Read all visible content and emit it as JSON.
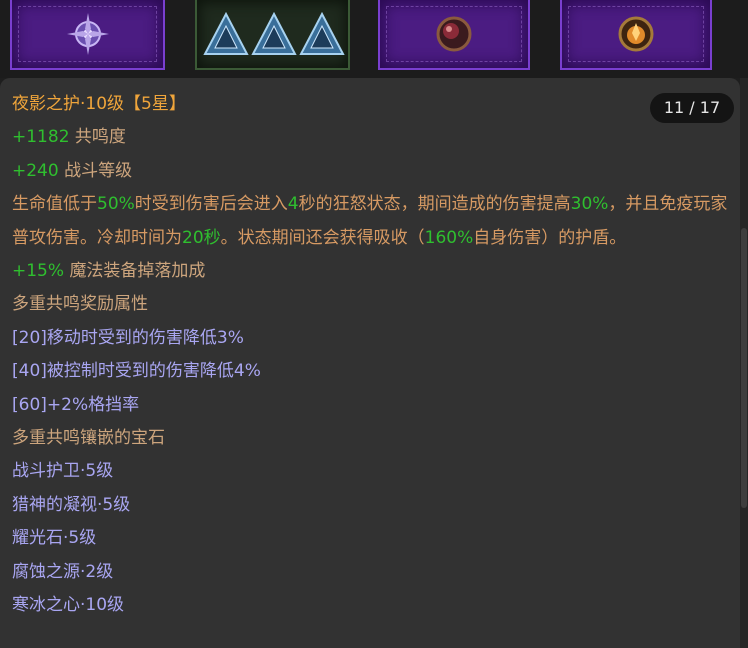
{
  "counter": "11 / 17",
  "item": {
    "name": "夜影之护·10级【5星】",
    "stats": [
      {
        "value": "+1182",
        "label": "共鸣度"
      },
      {
        "value": "+240",
        "label": "战斗等级"
      }
    ],
    "effect": {
      "p1": "生命值低于",
      "v1": "50%",
      "p2": "时受到伤害后会进入",
      "v2": "4",
      "p3": "秒的狂怒状态，期间造成的伤害提高",
      "v3": "30%",
      "p4": "，并且免疫玩家普攻伤害。冷却时间为",
      "v4": "20秒",
      "p5": "。状态期间还会获得吸收（",
      "v5": "160%",
      "p6": "自身伤害）的护盾。"
    },
    "magic_find": {
      "value": "+15%",
      "label": "魔法装备掉落加成"
    },
    "bonus_header": "多重共鸣奖励属性",
    "bonuses": [
      "[20]移动时受到的伤害降低3%",
      "[40]被控制时受到的伤害降低4%",
      "[60]+2%格挡率"
    ],
    "gems_header": "多重共鸣镶嵌的宝石",
    "gems": [
      "战斗护卫·5级",
      "猎神的凝视·5级",
      "耀光石·5级",
      "腐蚀之源·2级",
      "寒冰之心·10级"
    ]
  },
  "slots": [
    {
      "type": "purple",
      "icon": "starburst-gem-icon"
    },
    {
      "type": "green",
      "icon": "triangle-gem-icon"
    },
    {
      "type": "purple",
      "icon": "dark-orb-gem-icon"
    },
    {
      "type": "purple",
      "icon": "fire-orb-gem-icon"
    }
  ],
  "colors": {
    "title": "#f0a53b",
    "positive": "#2fbf2f",
    "neutral": "#cda57d",
    "description": "#d79a63",
    "bonus": "#a9a6f2",
    "panel": "#323232",
    "slot_purple": "#4b1c82"
  }
}
